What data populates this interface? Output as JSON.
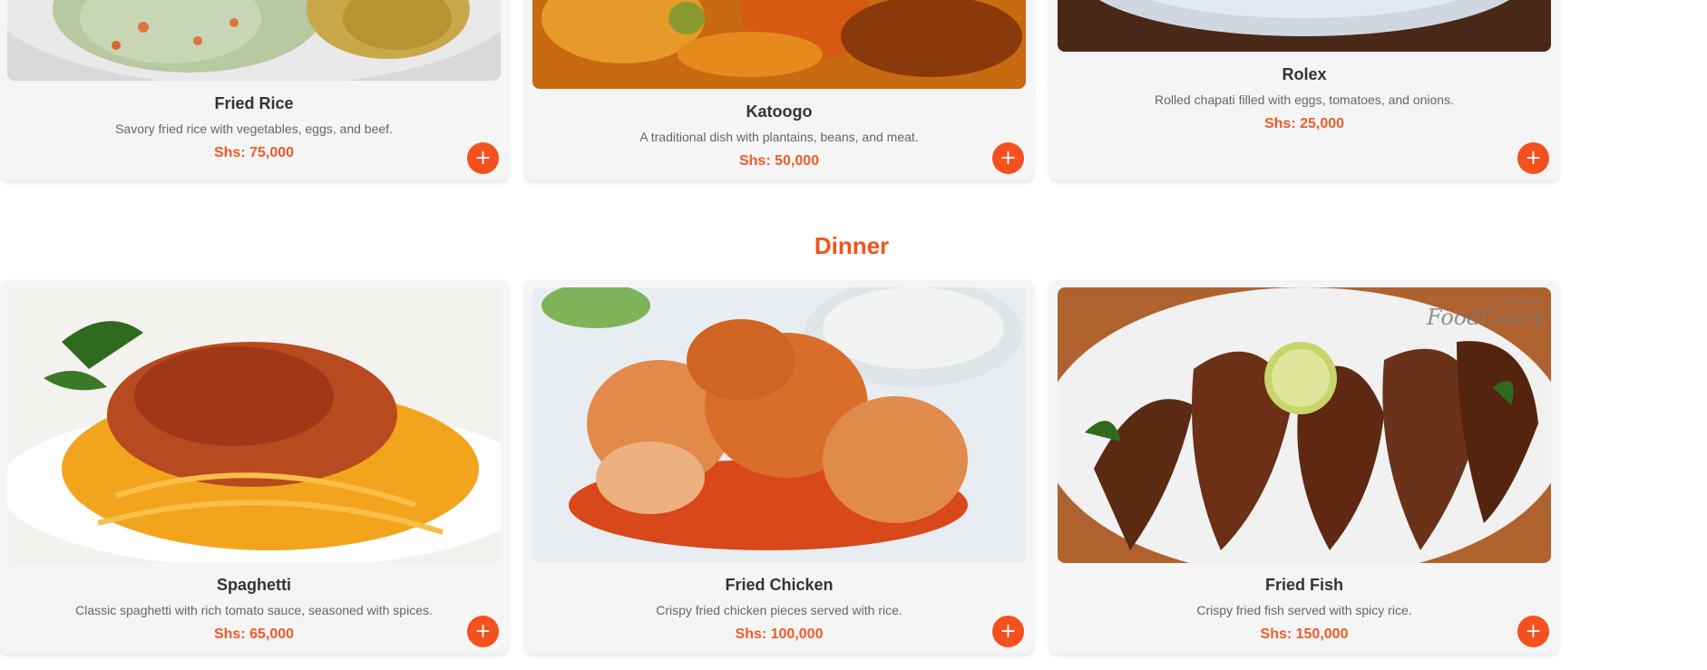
{
  "breakfast": {
    "items": [
      {
        "name": "Fried Rice",
        "description": "Savory fried rice with vegetables, eggs, and beef.",
        "price": "Shs: 75,000",
        "add_label": "+",
        "image_icon": "fried-rice-image"
      },
      {
        "name": "Katoogo",
        "description": "A traditional dish with plantains, beans, and meat.",
        "price": "Shs: 50,000",
        "add_label": "+",
        "image_icon": "katoogo-image"
      },
      {
        "name": "Rolex",
        "description": "Rolled chapati filled with eggs, tomatoes, and onions.",
        "price": "Shs: 25,000",
        "add_label": "+",
        "image_icon": "rolex-image"
      }
    ]
  },
  "dinner": {
    "title": "Dinner",
    "items": [
      {
        "name": "Spaghetti",
        "description": "Classic spaghetti with rich tomato sauce, seasoned with spices.",
        "price": "Shs: 65,000",
        "add_label": "+",
        "image_icon": "spaghetti-image"
      },
      {
        "name": "Fried Chicken",
        "description": "Crispy fried chicken pieces served with rice.",
        "price": "Shs: 100,000",
        "add_label": "+",
        "image_icon": "fried-chicken-image"
      },
      {
        "name": "Fried Fish",
        "description": "Crispy fried fish served with spicy rice.",
        "price": "Shs: 150,000",
        "add_label": "+",
        "image_icon": "fried-fish-image",
        "watermark": "Dindra's FoodCourt"
      }
    ]
  },
  "colors": {
    "accent": "#f4511e",
    "price": "#f05a28",
    "card_bg": "#f5f5f5"
  }
}
